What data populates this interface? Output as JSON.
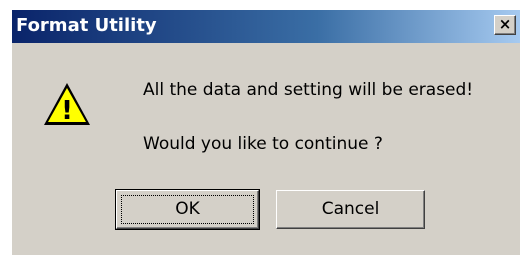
{
  "window": {
    "title": "Format Utility",
    "close_glyph": "×"
  },
  "icon": {
    "name": "warning-icon",
    "glyph": "!",
    "fill_color": "#ffff00"
  },
  "message": {
    "line1": "All the data and setting will be erased!",
    "line2": "Would you like to continue ?"
  },
  "buttons": {
    "ok_label": "OK",
    "cancel_label": "Cancel"
  },
  "colors": {
    "titlebar_start": "#0a246a",
    "titlebar_end": "#a6caf0",
    "dialog_face": "#d4d0c8"
  }
}
